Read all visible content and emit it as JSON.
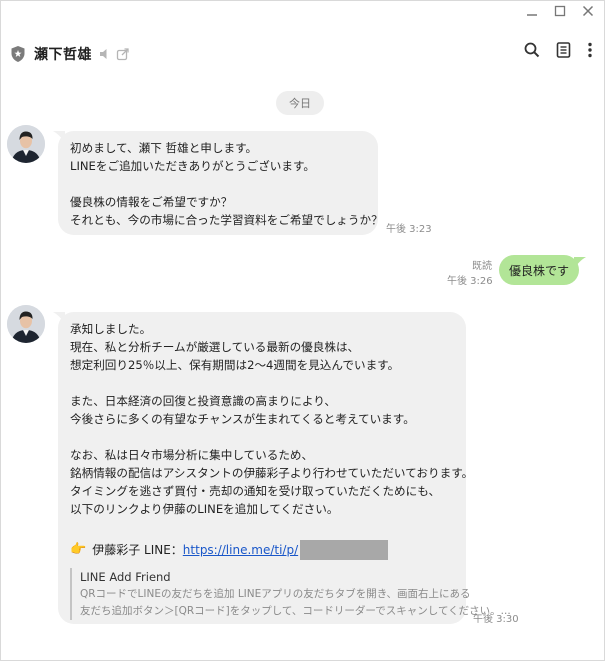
{
  "header": {
    "title": "瀬下哲雄"
  },
  "date_divider": "今日",
  "messages": {
    "m1": {
      "lines": [
        "初めまして、瀬下 哲雄と申します。",
        "LINEをご追加いただきありがとうございます。",
        "",
        "優良株の情報をご希望ですか？",
        "それとも、今の市場に合った学習資料をご希望でしょうか？"
      ],
      "time": "午後 3:23"
    },
    "m2": {
      "text": "優良株です",
      "read": "既読",
      "time": "午後 3:26"
    },
    "m3": {
      "lines": [
        "承知しました。",
        "現在、私と分析チームが厳選している最新の優良株は、",
        "想定利回り25％以上、保有期間は2〜4週間を見込んでいます。",
        "",
        "また、日本経済の回復と投資意識の高まりにより、",
        "今後さらに多くの有望なチャンスが生まれてくると考えています。",
        "",
        "なお、私は日々市場分析に集中しているため、",
        "銘柄情報の配信はアシスタントの伊藤彩子より行わせていただいております。",
        "タイミングを逃さず買付・売却の通知を受け取っていただくためにも、",
        "以下のリンクより伊藤のLINEを追加してください。"
      ],
      "link_label": "伊藤彩子 LINE：",
      "link_url": "https://line.me/ti/p/",
      "pointer_emoji": "👉",
      "preview": {
        "title": "LINE Add Friend",
        "desc_line1": "QRコードでLINEの友だちを追加 LINEアプリの友だちタブを開き、画面右上にある",
        "desc_line2": "友だち追加ボタン＞[QRコード]をタップして、コードリーダーでスキャンしてください。..."
      },
      "time": "午後 3:30"
    }
  }
}
